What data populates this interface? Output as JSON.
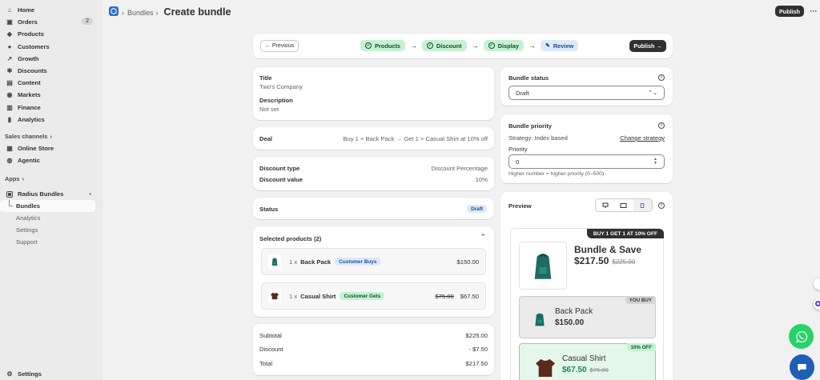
{
  "sidebar": {
    "items": [
      {
        "label": "Home",
        "icon": "home-icon"
      },
      {
        "label": "Orders",
        "icon": "orders-icon",
        "count": "2"
      },
      {
        "label": "Products",
        "icon": "tag-icon"
      },
      {
        "label": "Customers",
        "icon": "person-icon"
      },
      {
        "label": "Growth",
        "icon": "growth-icon"
      },
      {
        "label": "Discounts",
        "icon": "discount-icon"
      },
      {
        "label": "Content",
        "icon": "content-icon"
      },
      {
        "label": "Markets",
        "icon": "globe-icon"
      },
      {
        "label": "Finance",
        "icon": "bank-icon"
      },
      {
        "label": "Analytics",
        "icon": "chart-icon"
      }
    ],
    "sales_channels_label": "Sales channels",
    "channels": [
      {
        "label": "Online Store",
        "icon": "store-icon"
      },
      {
        "label": "Agentic",
        "icon": "agent-icon"
      }
    ],
    "apps_label": "Apps",
    "app": {
      "label": "Radius Bundles",
      "dot": "•"
    },
    "app_subitems": [
      "Bundles",
      "Analytics",
      "Settings",
      "Support"
    ],
    "settings_label": "Settings"
  },
  "topbar": {
    "breadcrumb_parent": "Bundles",
    "breadcrumb_sep": "›",
    "page_title": "Create bundle",
    "publish": "Publish",
    "more": "···"
  },
  "stepper": {
    "previous": "← Previous",
    "steps": [
      {
        "label": "Products"
      },
      {
        "label": "Discount"
      },
      {
        "label": "Display"
      },
      {
        "label": "Review"
      }
    ],
    "arrow": "→",
    "publish": "Publish →"
  },
  "summary": {
    "title_label": "Title",
    "title_value": "Two's Company",
    "description_label": "Description",
    "description_value": "Not set"
  },
  "deal": {
    "label": "Deal",
    "value": "Buy 1 × Back Pack → Get 1 × Casual Shirt at 10% off"
  },
  "discount": {
    "type_label": "Discount type",
    "type_value": "Discount Percentage",
    "value_label": "Discount value",
    "value_value": "10%"
  },
  "status": {
    "label": "Status",
    "badge": "Draft"
  },
  "products": {
    "title": "Selected products (2)",
    "items": [
      {
        "qty": "1 x",
        "name": "Back Pack",
        "badge": "Customer Buys",
        "price": "$150.00",
        "old_price": ""
      },
      {
        "qty": "1 x",
        "name": "Casual Shirt",
        "badge": "Customer Gets",
        "price": "$67.50",
        "old_price": "$75.00"
      }
    ]
  },
  "totals": {
    "subtotal_label": "Subtotal",
    "subtotal": "$225.00",
    "discount_label": "Discount",
    "discount": "- $7.50",
    "total_label": "Total",
    "total": "$217.50"
  },
  "bundle_status": {
    "title": "Bundle status",
    "selected": "Draft"
  },
  "priority": {
    "title": "Bundle priority",
    "strategy": "Strategy: Index based",
    "change": "Change strategy",
    "priority_label": "Priority",
    "priority_value": "0",
    "hint": "Higher number = higher priority (0–500)"
  },
  "preview": {
    "title": "Preview",
    "ribbon": "BUY 1 GET 1 AT 10% OFF",
    "bundle_title": "Bundle & Save",
    "bundle_price": "$217.50",
    "bundle_old": "$225.00",
    "you_buy": "YOU BUY",
    "item1_name": "Back Pack",
    "item1_price": "$150.00",
    "off_tag": "10% OFF",
    "item2_name": "Casual Shirt",
    "item2_price": "$67.50",
    "item2_old": "$75.00"
  },
  "colors": {
    "accent": "#303030",
    "green": "#0c5132",
    "green_bg": "#c7f1d0",
    "blue_bg": "#dbe9fb",
    "teal": "#1f6b63",
    "shirt": "#5b2a1c",
    "whatsapp": "#25d366",
    "chat": "#1f5fb4"
  }
}
